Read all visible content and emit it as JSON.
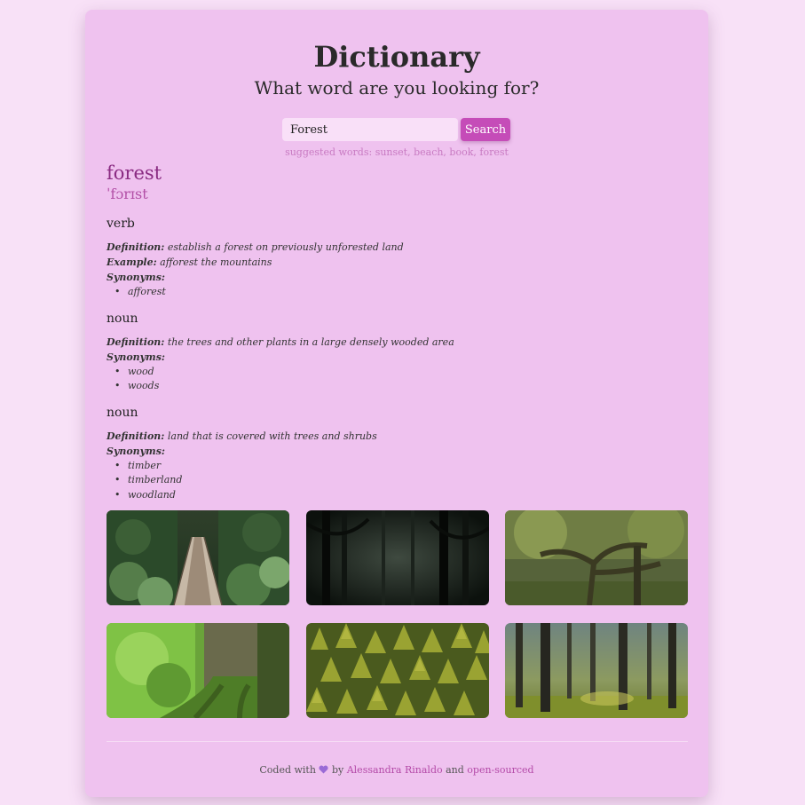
{
  "header": {
    "title": "Dictionary",
    "subtitle": "What word are you looking for?"
  },
  "search": {
    "value": "Forest",
    "button_label": "Search",
    "suggested": "suggested words: sunset, beach, book, forest"
  },
  "result": {
    "word": "forest",
    "phonetic": "ˈfɔrɪst",
    "meanings": [
      {
        "pos": "verb",
        "definition_label": "Definition:",
        "definition": "establish a forest on previously unforested land",
        "example_label": "Example:",
        "example": "afforest the mountains",
        "synonyms_label": "Synonyms:",
        "synonyms": [
          "afforest"
        ]
      },
      {
        "pos": "noun",
        "definition_label": "Definition:",
        "definition": "the trees and other plants in a large densely wooded area",
        "synonyms_label": "Synonyms:",
        "synonyms": [
          "wood",
          "woods"
        ]
      },
      {
        "pos": "noun",
        "definition_label": "Definition:",
        "definition": "land that is covered with trees and shrubs",
        "synonyms_label": "Synonyms:",
        "synonyms": [
          "timber",
          "timberland",
          "woodland"
        ]
      }
    ]
  },
  "footer": {
    "prefix": "Coded with",
    "by": "by",
    "author": "Alessandra Rinaldo",
    "and": "and",
    "link": "open-sourced",
    "heart_icon": "heart-icon"
  },
  "colors": {
    "accent": "#c54cb8",
    "card": "#efc2ef",
    "background": "#f8e1f7"
  }
}
